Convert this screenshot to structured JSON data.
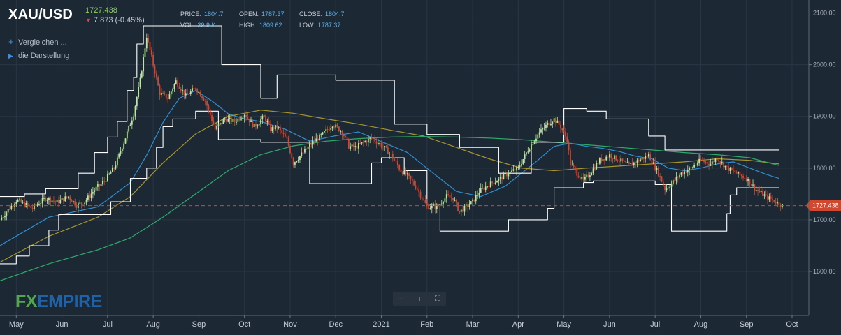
{
  "header": {
    "symbol": "XAU/USD",
    "last_price": "1727.438",
    "change": "7.873 (-0.45%)",
    "stats": [
      {
        "key": "PRICE:",
        "value": "1804.7"
      },
      {
        "key": "OPEN:",
        "value": "1787.37"
      },
      {
        "key": "CLOSE:",
        "value": "1804.7"
      },
      {
        "key": "VOL:",
        "value": "39.9 K"
      },
      {
        "key": "HIGH:",
        "value": "1809.62"
      },
      {
        "key": "LOW:",
        "value": "1787.37"
      }
    ]
  },
  "menu": {
    "compare": "Vergleichen ...",
    "display": "die Darstellung"
  },
  "logo": {
    "fx": "FX",
    "empire": "EMPIRE"
  },
  "colors": {
    "background": "#1d2835",
    "grid": "#2a3644",
    "bull": "#bde79b",
    "bear": "#d0482f",
    "channel": "#ffffff",
    "sma_fast": "#2e8fd1",
    "sma_mid": "#a8952e",
    "sma_slow": "#2fab6a",
    "price_badge": "#d0482f"
  },
  "chart_data": {
    "type": "candlestick",
    "title": "XAU/USD",
    "ylim": [
      1515,
      2125
    ],
    "y_ticks": [
      1600,
      1700,
      1800,
      1900,
      2000,
      2100
    ],
    "y_tick_labels": [
      "1600.00",
      "1700.00",
      "1800.00",
      "1900.00",
      "2000.00",
      "2100.00"
    ],
    "x_labels": [
      "May",
      "Jun",
      "Jul",
      "Aug",
      "Sep",
      "Oct",
      "Nov",
      "Dec",
      "2021",
      "Feb",
      "Mar",
      "Apr",
      "May",
      "Jun",
      "Jul",
      "Aug",
      "Sep",
      "Oct"
    ],
    "grid": true,
    "current_price": 1727.438,
    "current_price_label": "1727.438",
    "close_path": [
      [
        0,
        1700
      ],
      [
        10,
        1738
      ],
      [
        20,
        1722
      ],
      [
        28,
        1742
      ],
      [
        35,
        1734
      ],
      [
        42,
        1745
      ],
      [
        47,
        1728
      ],
      [
        52,
        1735
      ],
      [
        58,
        1758
      ],
      [
        64,
        1775
      ],
      [
        70,
        1800
      ],
      [
        76,
        1850
      ],
      [
        82,
        1905
      ],
      [
        86,
        1970
      ],
      [
        90,
        2055
      ],
      [
        94,
        2000
      ],
      [
        98,
        1945
      ],
      [
        103,
        1935
      ],
      [
        108,
        1968
      ],
      [
        114,
        1940
      ],
      [
        120,
        1955
      ],
      [
        126,
        1930
      ],
      [
        132,
        1875
      ],
      [
        138,
        1895
      ],
      [
        144,
        1890
      ],
      [
        150,
        1905
      ],
      [
        156,
        1880
      ],
      [
        162,
        1900
      ],
      [
        166,
        1875
      ],
      [
        170,
        1880
      ],
      [
        176,
        1855
      ],
      [
        180,
        1810
      ],
      [
        186,
        1830
      ],
      [
        192,
        1850
      ],
      [
        198,
        1865
      ],
      [
        204,
        1885
      ],
      [
        210,
        1870
      ],
      [
        214,
        1842
      ],
      [
        218,
        1840
      ],
      [
        222,
        1848
      ],
      [
        228,
        1858
      ],
      [
        234,
        1845
      ],
      [
        240,
        1825
      ],
      [
        246,
        1795
      ],
      [
        250,
        1785
      ],
      [
        256,
        1760
      ],
      [
        262,
        1725
      ],
      [
        268,
        1725
      ],
      [
        274,
        1745
      ],
      [
        278,
        1742
      ],
      [
        282,
        1715
      ],
      [
        286,
        1725
      ],
      [
        290,
        1735
      ],
      [
        294,
        1755
      ],
      [
        300,
        1768
      ],
      [
        306,
        1778
      ],
      [
        312,
        1790
      ],
      [
        318,
        1800
      ],
      [
        324,
        1835
      ],
      [
        330,
        1865
      ],
      [
        336,
        1885
      ],
      [
        340,
        1895
      ],
      [
        344,
        1880
      ],
      [
        348,
        1855
      ],
      [
        350,
        1808
      ],
      [
        354,
        1790
      ],
      [
        358,
        1775
      ],
      [
        362,
        1790
      ],
      [
        368,
        1815
      ],
      [
        374,
        1825
      ],
      [
        380,
        1815
      ],
      [
        386,
        1805
      ],
      [
        392,
        1815
      ],
      [
        398,
        1825
      ],
      [
        404,
        1790
      ],
      [
        408,
        1760
      ],
      [
        412,
        1770
      ],
      [
        418,
        1790
      ],
      [
        424,
        1800
      ],
      [
        430,
        1815
      ],
      [
        436,
        1808
      ],
      [
        440,
        1820
      ],
      [
        446,
        1800
      ],
      [
        452,
        1790
      ],
      [
        458,
        1780
      ],
      [
        464,
        1758
      ],
      [
        470,
        1745
      ],
      [
        476,
        1735
      ],
      [
        480,
        1727.438
      ]
    ],
    "series": [
      {
        "name": "",
        "style": "sma_fast",
        "points": [
          [
            0,
            1650
          ],
          [
            30,
            1705
          ],
          [
            60,
            1725
          ],
          [
            80,
            1772
          ],
          [
            90,
            1825
          ],
          [
            100,
            1888
          ],
          [
            110,
            1935
          ],
          [
            120,
            1950
          ],
          [
            130,
            1930
          ],
          [
            140,
            1905
          ],
          [
            150,
            1895
          ],
          [
            160,
            1890
          ],
          [
            175,
            1875
          ],
          [
            190,
            1852
          ],
          [
            205,
            1862
          ],
          [
            220,
            1870
          ],
          [
            235,
            1850
          ],
          [
            250,
            1830
          ],
          [
            265,
            1792
          ],
          [
            280,
            1755
          ],
          [
            295,
            1745
          ],
          [
            310,
            1765
          ],
          [
            320,
            1790
          ],
          [
            330,
            1815
          ],
          [
            340,
            1842
          ],
          [
            350,
            1848
          ],
          [
            360,
            1842
          ],
          [
            370,
            1838
          ],
          [
            380,
            1832
          ],
          [
            390,
            1823
          ],
          [
            400,
            1818
          ],
          [
            410,
            1800
          ],
          [
            420,
            1795
          ],
          [
            430,
            1800
          ],
          [
            440,
            1808
          ],
          [
            450,
            1812
          ],
          [
            460,
            1800
          ],
          [
            470,
            1788
          ],
          [
            478,
            1780
          ]
        ]
      },
      {
        "name": "",
        "style": "sma_mid",
        "points": [
          [
            0,
            1618
          ],
          [
            30,
            1668
          ],
          [
            60,
            1705
          ],
          [
            80,
            1745
          ],
          [
            100,
            1810
          ],
          [
            120,
            1866
          ],
          [
            140,
            1900
          ],
          [
            160,
            1912
          ],
          [
            180,
            1906
          ],
          [
            200,
            1895
          ],
          [
            220,
            1885
          ],
          [
            240,
            1873
          ],
          [
            260,
            1862
          ],
          [
            280,
            1840
          ],
          [
            300,
            1818
          ],
          [
            320,
            1800
          ],
          [
            340,
            1795
          ],
          [
            360,
            1800
          ],
          [
            380,
            1804
          ],
          [
            400,
            1808
          ],
          [
            420,
            1812
          ],
          [
            440,
            1818
          ],
          [
            460,
            1815
          ],
          [
            478,
            1808
          ]
        ]
      },
      {
        "name": "",
        "style": "sma_slow",
        "points": [
          [
            0,
            1582
          ],
          [
            30,
            1615
          ],
          [
            60,
            1642
          ],
          [
            80,
            1665
          ],
          [
            100,
            1705
          ],
          [
            120,
            1750
          ],
          [
            140,
            1795
          ],
          [
            160,
            1826
          ],
          [
            180,
            1843
          ],
          [
            200,
            1852
          ],
          [
            220,
            1857
          ],
          [
            240,
            1860
          ],
          [
            260,
            1861
          ],
          [
            280,
            1860
          ],
          [
            300,
            1858
          ],
          [
            320,
            1855
          ],
          [
            340,
            1850
          ],
          [
            360,
            1845
          ],
          [
            380,
            1840
          ],
          [
            400,
            1835
          ],
          [
            420,
            1830
          ],
          [
            440,
            1826
          ],
          [
            460,
            1820
          ],
          [
            478,
            1805
          ]
        ]
      },
      {
        "name": "",
        "style": "channel_upper",
        "points": [
          [
            0,
            1745
          ],
          [
            15,
            1745
          ],
          [
            15,
            1750
          ],
          [
            28,
            1750
          ],
          [
            28,
            1760
          ],
          [
            48,
            1760
          ],
          [
            48,
            1790
          ],
          [
            58,
            1790
          ],
          [
            58,
            1830
          ],
          [
            66,
            1830
          ],
          [
            66,
            1860
          ],
          [
            72,
            1860
          ],
          [
            72,
            1890
          ],
          [
            78,
            1890
          ],
          [
            78,
            1950
          ],
          [
            82,
            1950
          ],
          [
            82,
            1975
          ],
          [
            84,
            1975
          ],
          [
            84,
            2040
          ],
          [
            88,
            2040
          ],
          [
            88,
            2075
          ],
          [
            136,
            2075
          ],
          [
            136,
            2000
          ],
          [
            160,
            2000
          ],
          [
            160,
            1935
          ],
          [
            170,
            1935
          ],
          [
            170,
            1980
          ],
          [
            206,
            1980
          ],
          [
            206,
            1970
          ],
          [
            242,
            1970
          ],
          [
            242,
            1885
          ],
          [
            262,
            1885
          ],
          [
            262,
            1865
          ],
          [
            282,
            1865
          ],
          [
            282,
            1840
          ],
          [
            306,
            1840
          ],
          [
            306,
            1790
          ],
          [
            326,
            1790
          ],
          [
            326,
            1850
          ],
          [
            346,
            1850
          ],
          [
            346,
            1915
          ],
          [
            360,
            1915
          ],
          [
            360,
            1910
          ],
          [
            372,
            1910
          ],
          [
            372,
            1895
          ],
          [
            398,
            1895
          ],
          [
            398,
            1862
          ],
          [
            408,
            1862
          ],
          [
            408,
            1835
          ],
          [
            478,
            1835
          ]
        ]
      },
      {
        "name": "",
        "style": "channel_lower",
        "points": [
          [
            0,
            1615
          ],
          [
            10,
            1615
          ],
          [
            10,
            1630
          ],
          [
            18,
            1630
          ],
          [
            18,
            1650
          ],
          [
            30,
            1650
          ],
          [
            30,
            1680
          ],
          [
            36,
            1680
          ],
          [
            36,
            1710
          ],
          [
            68,
            1710
          ],
          [
            68,
            1735
          ],
          [
            80,
            1735
          ],
          [
            80,
            1780
          ],
          [
            90,
            1780
          ],
          [
            90,
            1800
          ],
          [
            96,
            1800
          ],
          [
            96,
            1840
          ],
          [
            100,
            1840
          ],
          [
            100,
            1880
          ],
          [
            106,
            1880
          ],
          [
            106,
            1895
          ],
          [
            120,
            1895
          ],
          [
            120,
            1910
          ],
          [
            134,
            1910
          ],
          [
            134,
            1855
          ],
          [
            160,
            1855
          ],
          [
            160,
            1850
          ],
          [
            190,
            1850
          ],
          [
            190,
            1770
          ],
          [
            228,
            1770
          ],
          [
            228,
            1810
          ],
          [
            234,
            1810
          ],
          [
            234,
            1820
          ],
          [
            248,
            1820
          ],
          [
            248,
            1795
          ],
          [
            262,
            1795
          ],
          [
            262,
            1730
          ],
          [
            270,
            1730
          ],
          [
            270,
            1678
          ],
          [
            312,
            1678
          ],
          [
            312,
            1700
          ],
          [
            336,
            1700
          ],
          [
            336,
            1722
          ],
          [
            340,
            1722
          ],
          [
            340,
            1762
          ],
          [
            358,
            1762
          ],
          [
            358,
            1772
          ],
          [
            364,
            1772
          ],
          [
            364,
            1775
          ],
          [
            402,
            1775
          ],
          [
            402,
            1768
          ],
          [
            412,
            1768
          ],
          [
            412,
            1678
          ],
          [
            446,
            1678
          ],
          [
            446,
            1712
          ],
          [
            448,
            1712
          ],
          [
            448,
            1748
          ],
          [
            452,
            1748
          ],
          [
            452,
            1762
          ],
          [
            478,
            1762
          ]
        ]
      }
    ]
  }
}
